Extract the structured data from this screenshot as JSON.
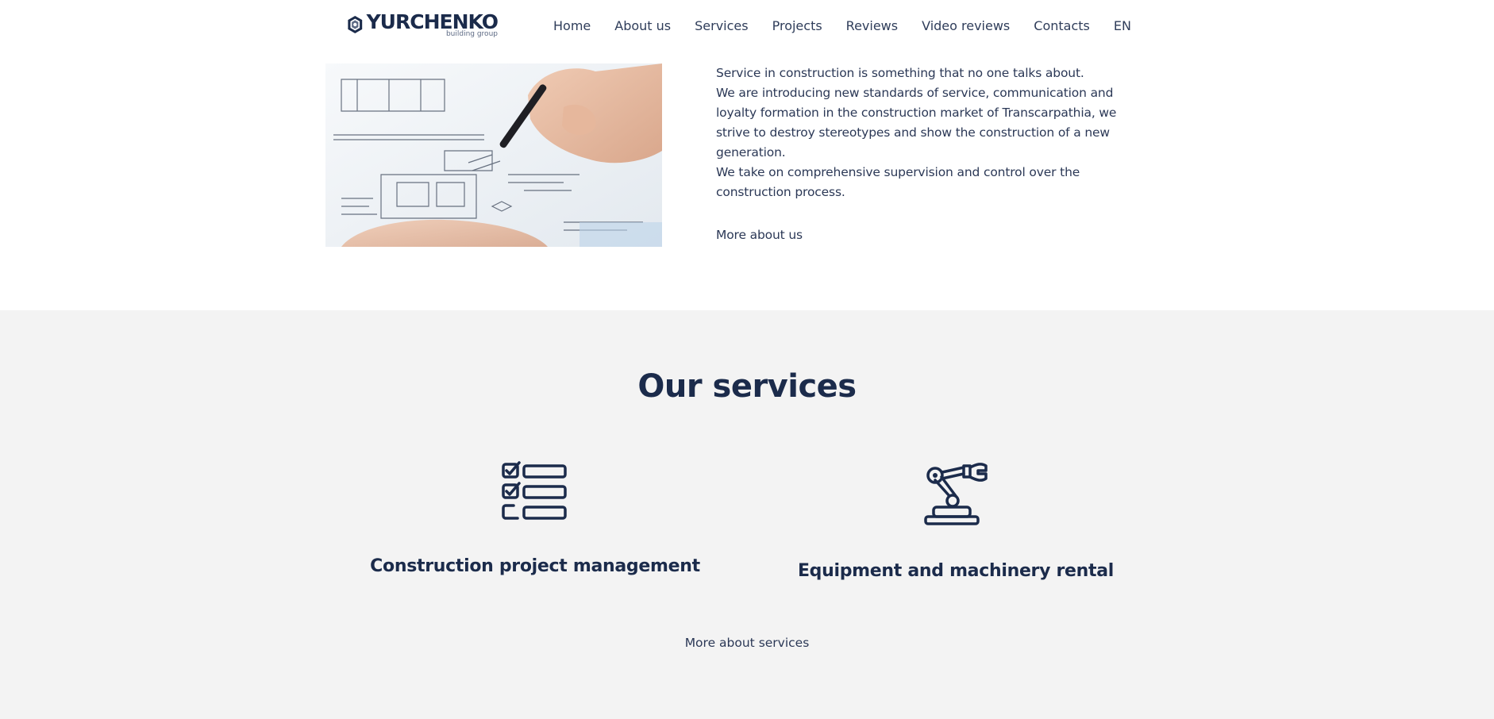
{
  "brand": {
    "name": "YURCHENKO",
    "tagline": "building group",
    "primary_color": "#1b2b4b",
    "section_bg": "#f3f3f3"
  },
  "nav": {
    "items": [
      {
        "label": "Home"
      },
      {
        "label": "About us"
      },
      {
        "label": "Services"
      },
      {
        "label": "Projects"
      },
      {
        "label": "Reviews"
      },
      {
        "label": "Video reviews"
      },
      {
        "label": "Contacts"
      },
      {
        "label": "EN"
      }
    ]
  },
  "about": {
    "image_icon": "architect-drawing-photo",
    "paragraphs": [
      "Service in construction is something that no one talks about.",
      "We are introducing new standards of service, communication and loyalty formation in the construction market of Transcarpathia, we strive to destroy stereotypes and show the construction of a new generation.",
      "We take on comprehensive supervision and control over the construction process."
    ],
    "more_link": "More about us"
  },
  "services": {
    "title": "Our services",
    "items": [
      {
        "name": "Construction project management",
        "icon": "checklist-icon"
      },
      {
        "name": "Equipment and machinery rental",
        "icon": "robotic-arm-icon"
      }
    ],
    "more_link": "More about services"
  }
}
